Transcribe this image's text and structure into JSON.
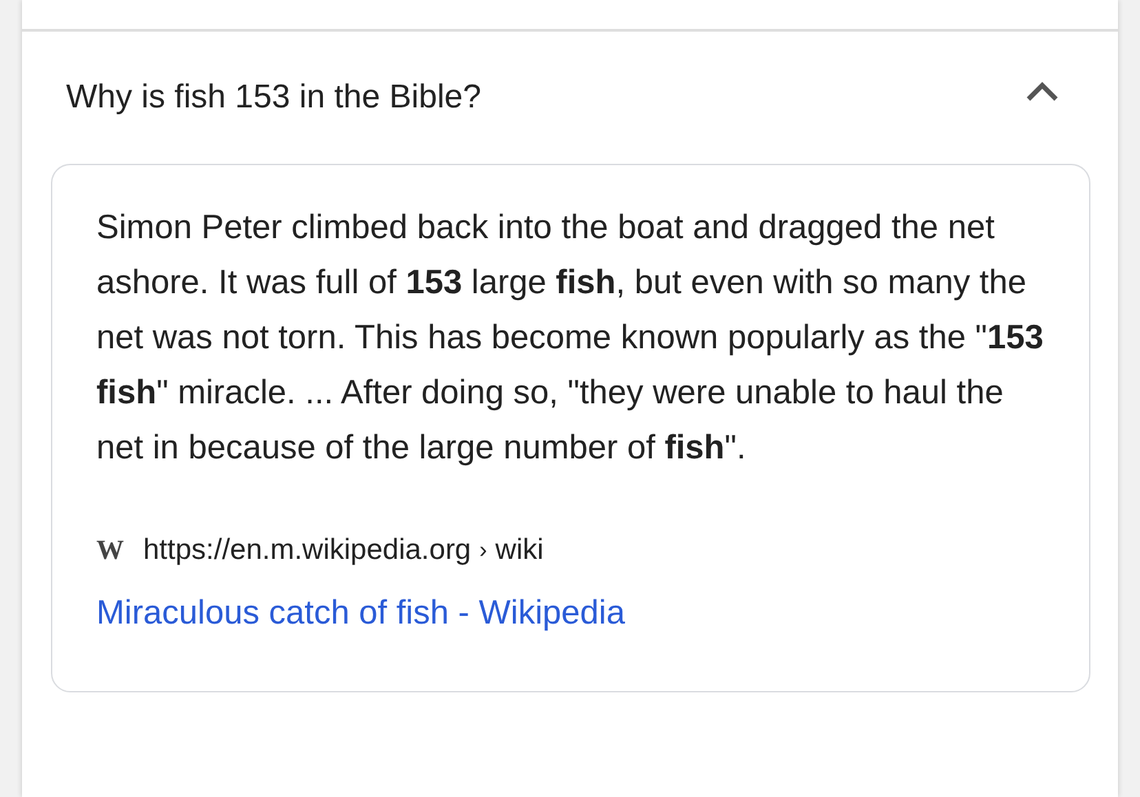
{
  "question": {
    "text": "Why is fish 153 in the Bible?",
    "expanded": true
  },
  "answer": {
    "snippet": "Simon Peter climbed back into the boat and dragged the net ashore. It was full of **153** large **fish**, but even with so many the net was not torn. This has become known popularly as the \"**153 fish**\" miracle. ... After doing so, \"they were unable to haul the net in because of the large number of **fish**\".",
    "source": {
      "favicon": "W",
      "url": "https://en.m.wikipedia.org",
      "separator": "›",
      "path": "wiki"
    },
    "link": "Miraculous catch of fish - Wikipedia"
  }
}
